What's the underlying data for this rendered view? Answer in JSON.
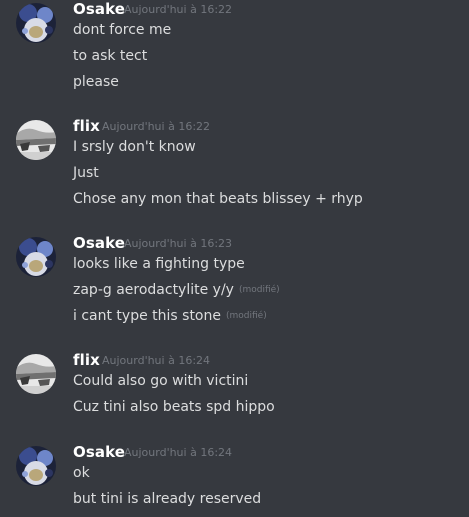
{
  "messages": [
    {
      "author": "Osake",
      "timestamp": "Aujourd'hui à 16:22",
      "lines": [
        {
          "text": "dont force me",
          "edited": ""
        },
        {
          "text": "to ask tect",
          "edited": ""
        },
        {
          "text": "please",
          "edited": ""
        }
      ]
    },
    {
      "author": "flix",
      "timestamp": "Aujourd'hui à 16:22",
      "lines": [
        {
          "text": "I srsly don't know",
          "edited": ""
        },
        {
          "text": "Just",
          "edited": ""
        },
        {
          "text": "Chose any mon that beats blissey + rhyp",
          "edited": ""
        }
      ]
    },
    {
      "author": "Osake",
      "timestamp": "Aujourd'hui à 16:23",
      "lines": [
        {
          "text": "looks like a fighting type",
          "edited": ""
        },
        {
          "text": "zap-g aerodactylite y/y",
          "edited": "(modifié)"
        },
        {
          "text": "i cant type this stone",
          "edited": "(modifié)"
        }
      ]
    },
    {
      "author": "flix",
      "timestamp": "Aujourd'hui à 16:24",
      "lines": [
        {
          "text": "Could also go with victini",
          "edited": ""
        },
        {
          "text": "Cuz tini also beats spd hippo",
          "edited": ""
        }
      ]
    },
    {
      "author": "Osake",
      "timestamp": "Aujourd'hui à 16:24",
      "lines": [
        {
          "text": "ok",
          "edited": ""
        },
        {
          "text": "but tini is already reserved",
          "edited": ""
        }
      ]
    }
  ],
  "colors": {
    "background": "#36393f",
    "username": "#ffffff",
    "message_text": "#dcddde",
    "timestamp": "#72767d"
  }
}
